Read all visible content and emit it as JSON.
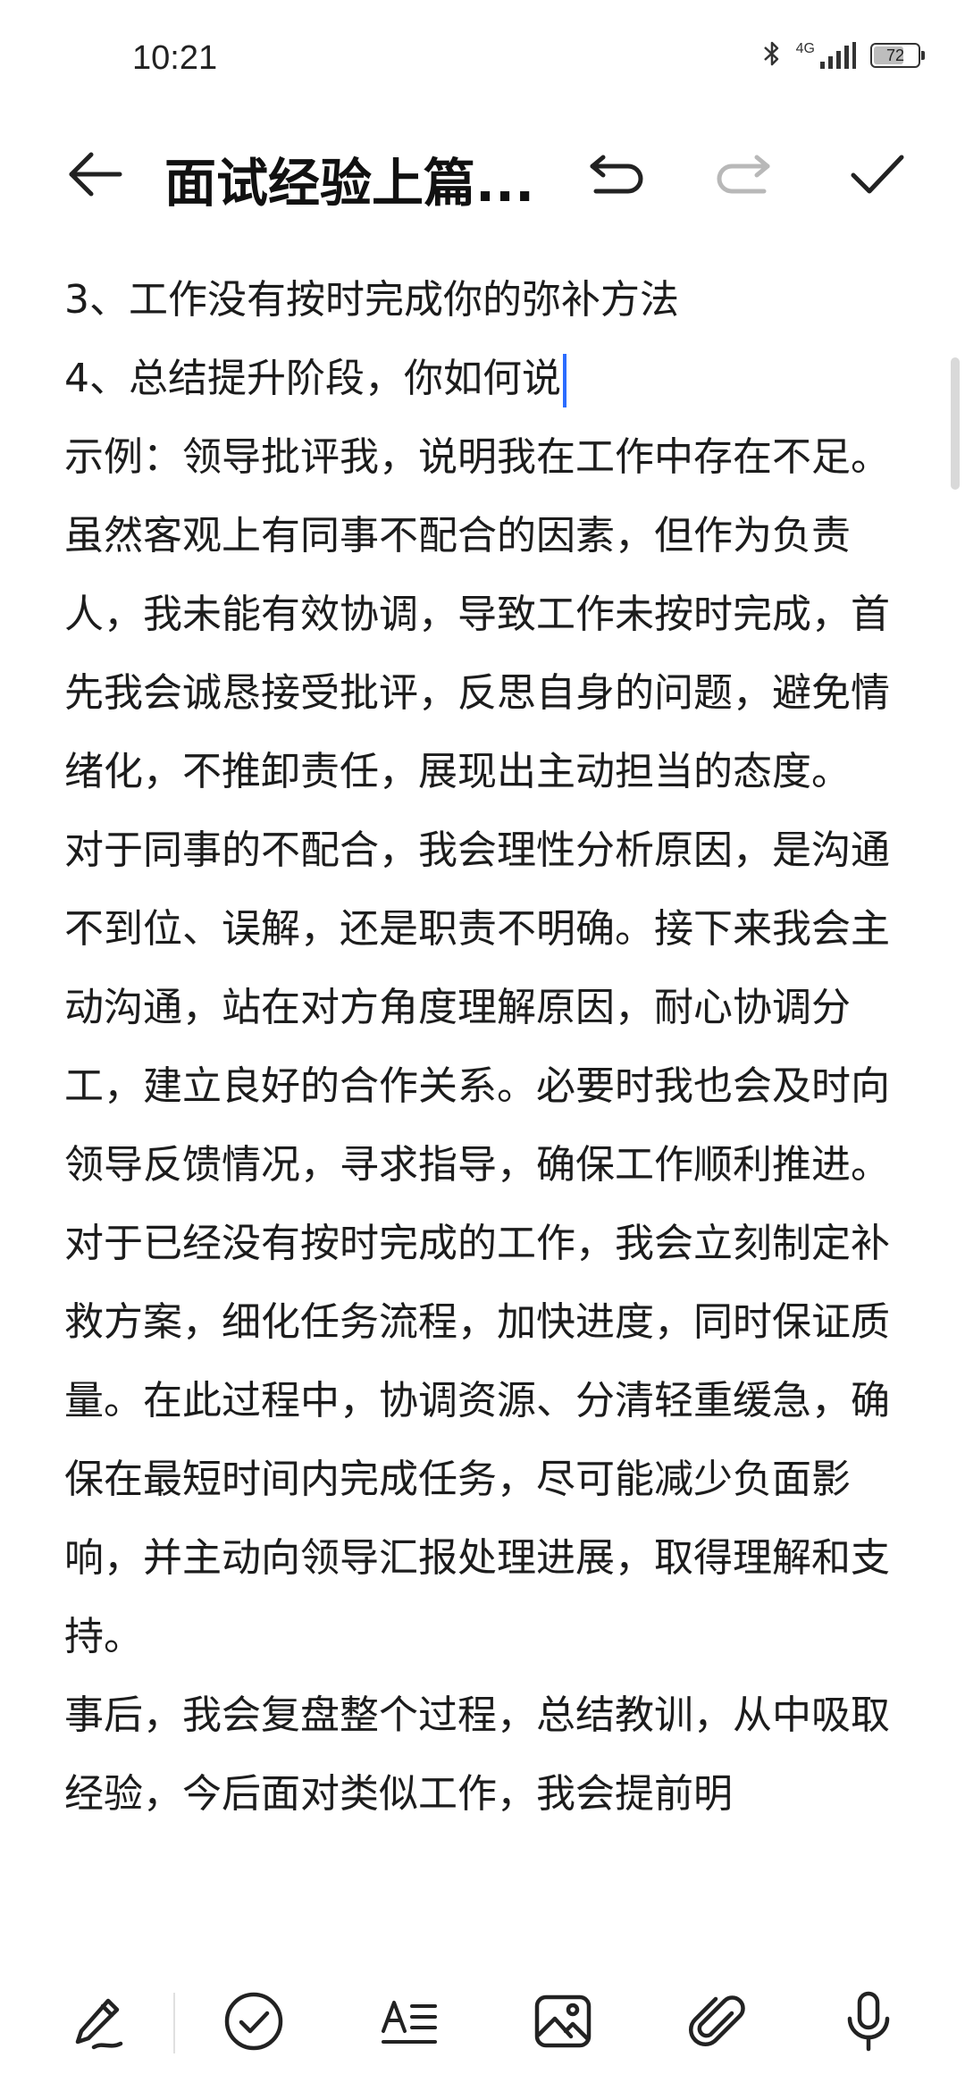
{
  "status_bar": {
    "time": "10:21",
    "network": "4G",
    "battery_level": "72",
    "icons": [
      "bluetooth-icon",
      "signal-icon",
      "battery-icon"
    ]
  },
  "toolbar": {
    "title": "面试经验上篇...",
    "icons": [
      "back-arrow-icon",
      "undo-icon",
      "redo-icon",
      "check-icon"
    ]
  },
  "content": {
    "paragraphs": [
      "3、工作没有按时完成你的弥补方法",
      "4、总结提升阶段，你如何说",
      "示例：领导批评我，说明我在工作中存在不足。虽然客观上有同事不配合的因素，但作为负责人，我未能有效协调，导致工作未按时完成，首先我会诚恳接受批评，反思自身的问题，避免情绪化，不推卸责任，展现出主动担当的态度。",
      "对于同事的不配合，我会理性分析原因，是沟通不到位、误解，还是职责不明确。接下来我会主动沟通，站在对方角度理解原因，耐心协调分工，建立良好的合作关系。必要时我也会及时向领导反馈情况，寻求指导，确保工作顺利推进。",
      "对于已经没有按时完成的工作，我会立刻制定补救方案，细化任务流程，加快进度，同时保证质量。在此过程中，协调资源、分清轻重缓急，确保在最短时间内完成任务，尽可能减少负面影响，并主动向领导汇报处理进展，取得理解和支持。",
      "事后，我会复盘整个过程，总结教训，从中吸取经验，今后面对类似工作，我会提前明"
    ]
  },
  "bottom_bar": {
    "icons": [
      "handwriting-pen-icon",
      "checklist-icon",
      "text-format-icon",
      "image-icon",
      "attachment-icon",
      "microphone-icon"
    ]
  },
  "colors": {
    "background": "#ffffff",
    "text": "#1c1c1c",
    "cursor": "#2b6cff",
    "disabled_icon": "#b8b8b8"
  }
}
